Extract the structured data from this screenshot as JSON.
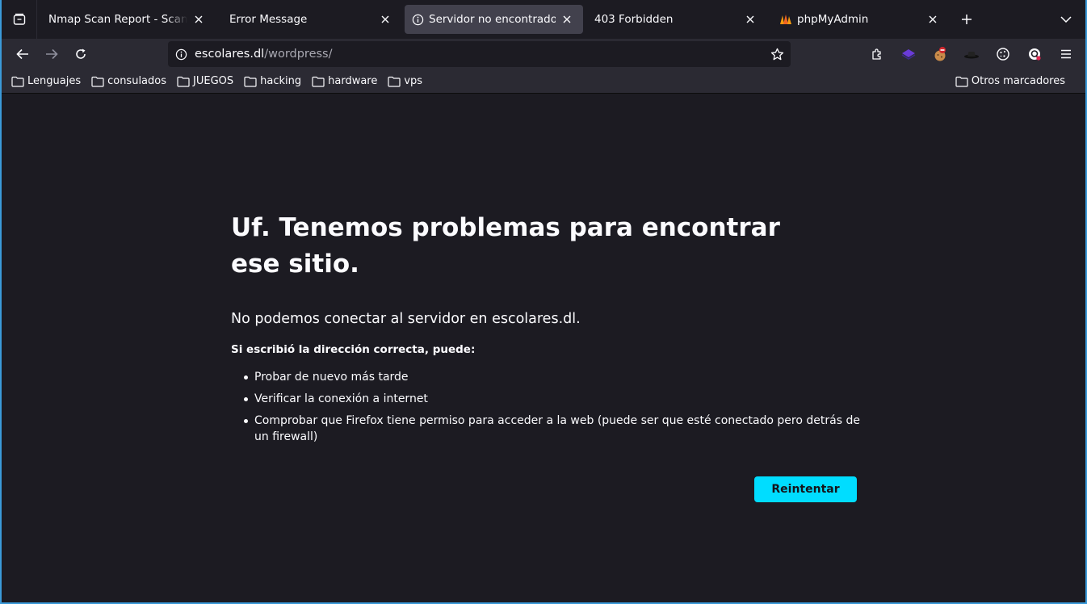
{
  "tabs": [
    {
      "title": "Nmap Scan Report - Scanned at",
      "active": false
    },
    {
      "title": "Error Message",
      "active": false
    },
    {
      "title": "Servidor no encontrado",
      "active": true
    },
    {
      "title": "403 Forbidden",
      "active": false
    },
    {
      "title": "phpMyAdmin",
      "active": false
    }
  ],
  "url": {
    "host": "escolares.dl",
    "path": "/wordpress/"
  },
  "bookmarks": [
    "Lenguajes",
    "consulados",
    "JUEGOS",
    "hacking",
    "hardware",
    "vps"
  ],
  "other_bookmarks": "Otros marcadores",
  "error": {
    "title": "Uf. Tenemos problemas para encontrar ese sitio.",
    "description": "No podemos conectar al servidor en escolares.dl.",
    "subtitle": "Si escribió la dirección correcta, puede:",
    "suggestions": [
      "Probar de nuevo más tarde",
      "Verificar la conexión a internet",
      "Comprobar que Firefox tiene permiso para acceder a la web (puede ser que esté conectado pero detrás de un firewall)"
    ],
    "retry_label": "Reintentar"
  },
  "colors": {
    "accent": "#00ddff",
    "frame": "#3b9ad9"
  }
}
